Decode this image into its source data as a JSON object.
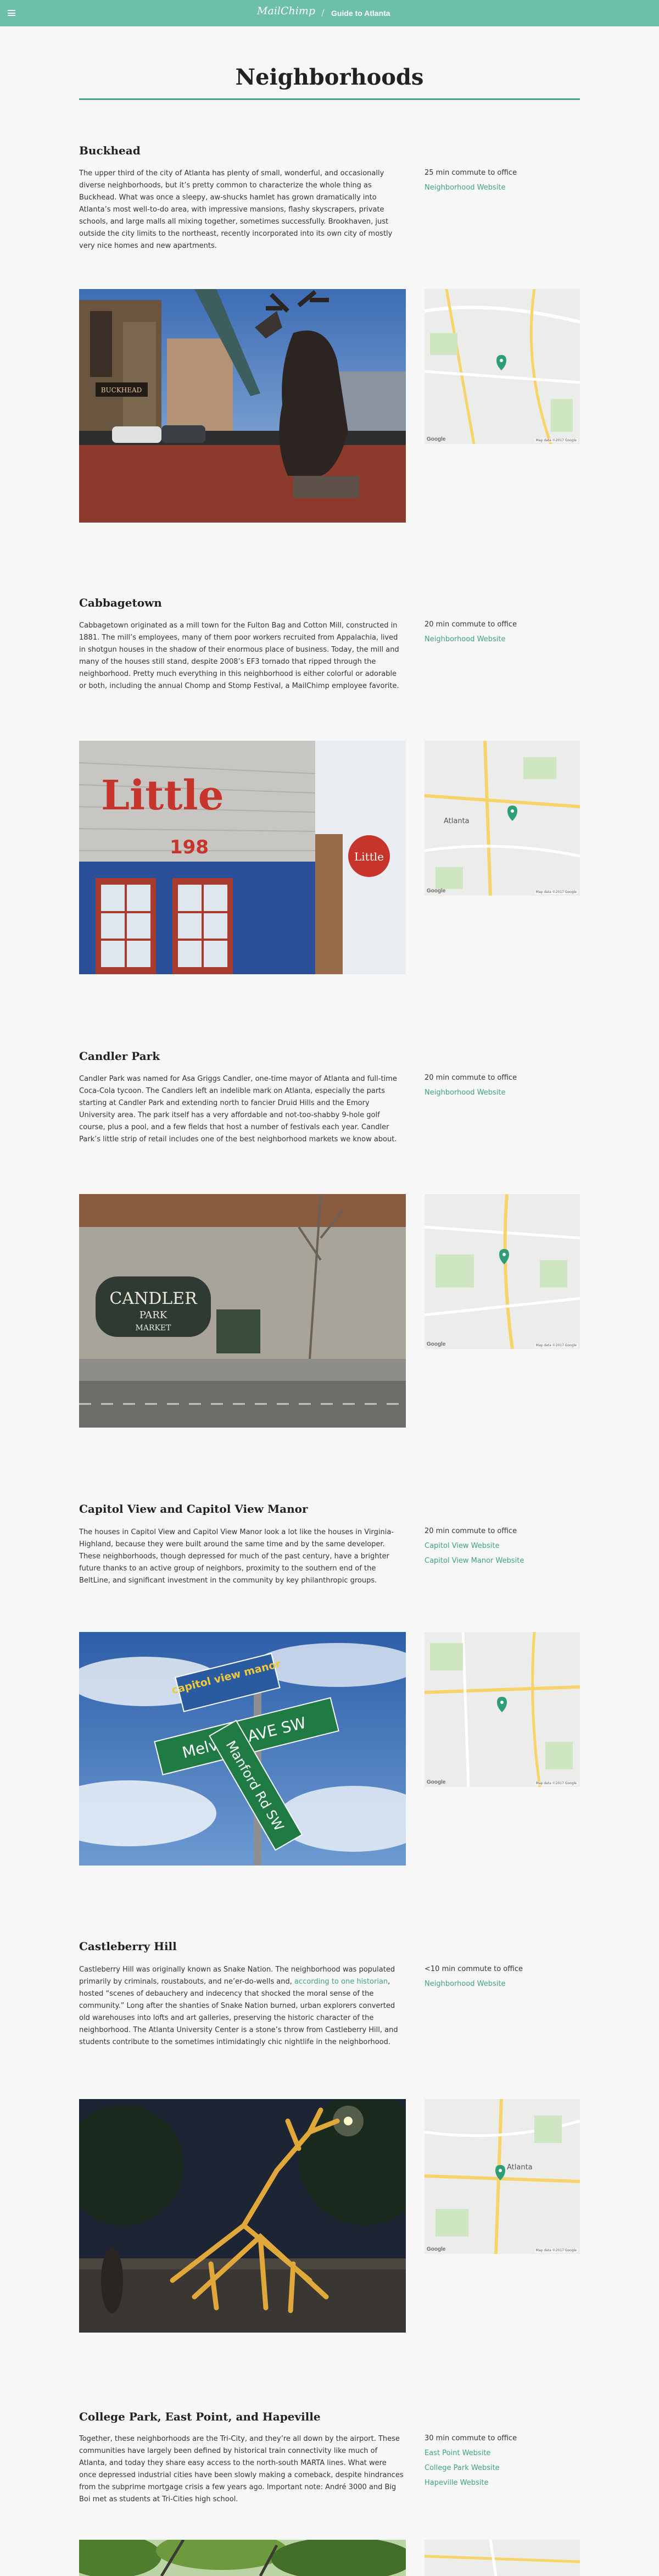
{
  "header": {
    "brand": "MailChimp",
    "separator": "/",
    "guide_title": "Guide to Atlanta"
  },
  "page": {
    "title": "Neighborhoods"
  },
  "map_labels": {
    "logo": "Google",
    "attribution": "Map data ©2017 Google"
  },
  "neighborhoods": [
    {
      "name": "Buckhead",
      "description": "The upper third of the city of Atlanta has plenty of small, wonderful, and occasionally diverse neighborhoods, but it’s pretty common to characterize the whole thing as Buckhead. What was once a sleepy, aw-shucks hamlet has grown dramatically into Atlanta’s most well-to-do area, with impressive mansions, flashy skyscrapers, private schools, and large malls all mixing together, sometimes successfully. Brookhaven, just outside the city limits to the northeast, recently incorporated into its own city of mostly very nice homes and new apartments.",
      "commute": "25 min commute to office",
      "links": [
        "Neighborhood Website"
      ],
      "photo": "buckhead-deer-statue",
      "photo_sign": "BUCKHEAD"
    },
    {
      "name": "Cabbagetown",
      "description": "Cabbagetown originated as a mill town for the Fulton Bag and Cotton Mill, constructed in 1881. The mill’s employees, many of them poor workers recruited from Appalachia, lived in shotgun houses in the shadow of their enormous place of business. Today, the mill and many of the houses still stand, despite 2008’s EF3 tornado that ripped through the neighborhood. Pretty much everything in this neighborhood is either colorful or adorable or both, including the annual Chomp and Stomp Festival, a MailChimp employee favorite.",
      "commute": "20 min commute to office",
      "links": [
        "Neighborhood Website"
      ],
      "photo": "cabbagetown-little-store",
      "photo_sign": "Little",
      "photo_sign_small": "198",
      "photo_sign_round": "Little"
    },
    {
      "name": "Candler Park",
      "description": "Candler Park was named for Asa Griggs Candler, one-time mayor of Atlanta and full-time Coca-Cola tycoon. The Candlers left an indelible mark on Atlanta, especially the parts starting at Candler Park and extending north to fancier Druid Hills and the Emory University area. The park itself has a very affordable and not-too-shabby 9-hole golf course, plus a pool, and a few fields that host a number of festivals each year. Candler Park’s little strip of retail includes one of the best neighborhood markets we know about.",
      "commute": "20 min commute to office",
      "links": [
        "Neighborhood Website"
      ],
      "photo": "candler-park-market",
      "photo_sign": "CANDLER",
      "photo_sign_mid": "PARK",
      "photo_sign_low": "MARKET"
    },
    {
      "name": "Capitol View and Capitol View Manor",
      "description": "The houses in Capitol View and Capitol View Manor look a lot like the houses in Virginia-Highland, because they were built around the same time and by the same developer. These neighborhoods, though depressed for much of the past century, have a brighter future thanks to an active group of neighbors, proximity to the southern end of the BeltLine, and significant investment in the community by key philanthropic groups.",
      "commute": "20 min commute to office",
      "links": [
        "Capitol View Website",
        "Capitol View Manor Website"
      ],
      "photo": "capitol-view-street-signs",
      "photo_sign": "capitol view manor",
      "photo_sign_mid": "Melview AVE SW",
      "photo_sign_low": "Manford Rd SW"
    },
    {
      "name": "Castleberry Hill",
      "description_before": "Castleberry Hill was originally known as Snake Nation. The neighborhood was populated primarily by criminals, roustabouts, and ne’er-do-wells and, ",
      "description_link": "according to one historian",
      "description_after": ", hosted “scenes of debauchery and indecency that shocked the moral sense of the community.” Long after the shanties of Snake Nation burned, urban explorers converted old warehouses into lofts and art galleries, preserving the historic character of the neighborhood. The Atlanta University Center is a stone’s throw from Castleberry Hill, and students contribute to the sometimes intimidatingly chic nightlife in the neighborhood.",
      "commute": "<10 min commute to office",
      "links": [
        "Neighborhood Website"
      ],
      "photo": "castleberry-hill-sculpture"
    },
    {
      "name": "College Park, East Point, and Hapeville",
      "description": "Together, these neighborhoods are the Tri-City, and they’re all down by the airport. These communities have largely been defined by historical train connectivity like much of Atlanta, and today they share easy access to the north-south MARTA lines. What were once depressed industrial cities have been slowly making a comeback, despite hindrances from the subprime mortgage crisis a few years ago. Important note: André 3000 and Big Boi met as students at Tri-Cities high school.",
      "commute": "30 min commute to office",
      "links": [
        "East Point Website",
        "College Park Website",
        "Hapeville Website"
      ],
      "photo": "tri-city-trees"
    }
  ]
}
